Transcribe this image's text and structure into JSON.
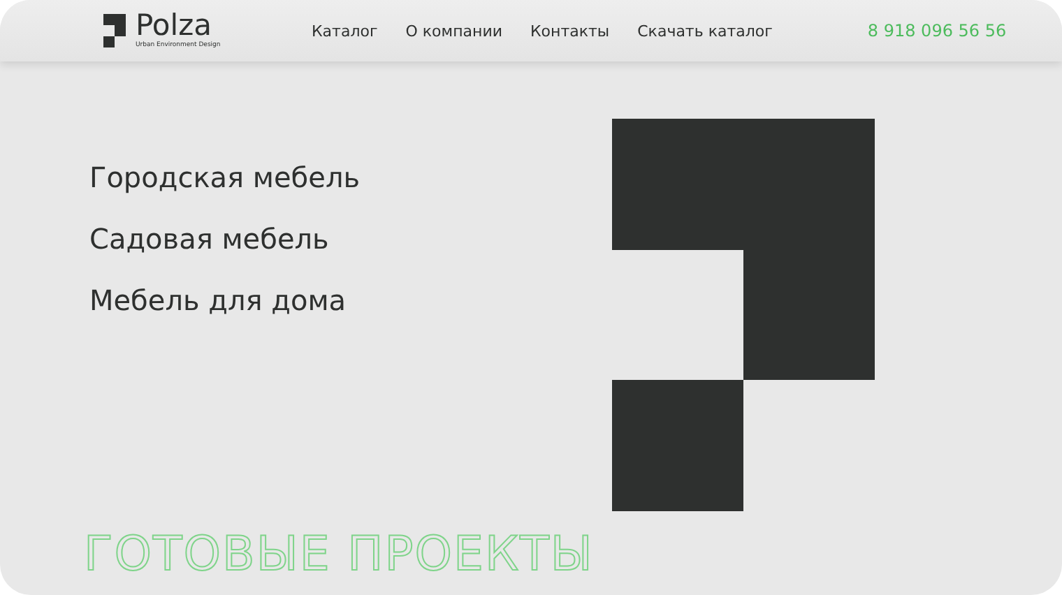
{
  "header": {
    "logo": {
      "name": "Polza",
      "tagline": "Urban Environment Design"
    },
    "nav": [
      {
        "label": "Каталог"
      },
      {
        "label": "О компании"
      },
      {
        "label": "Контакты"
      },
      {
        "label": "Скачать каталог"
      }
    ],
    "phone": "8 918 096 56 56"
  },
  "categories": [
    {
      "label": "Городская мебель"
    },
    {
      "label": "Садовая мебель"
    },
    {
      "label": "Мебель для дома"
    }
  ],
  "section_title": "ГОТОВЫЕ ПРОЕКТЫ"
}
